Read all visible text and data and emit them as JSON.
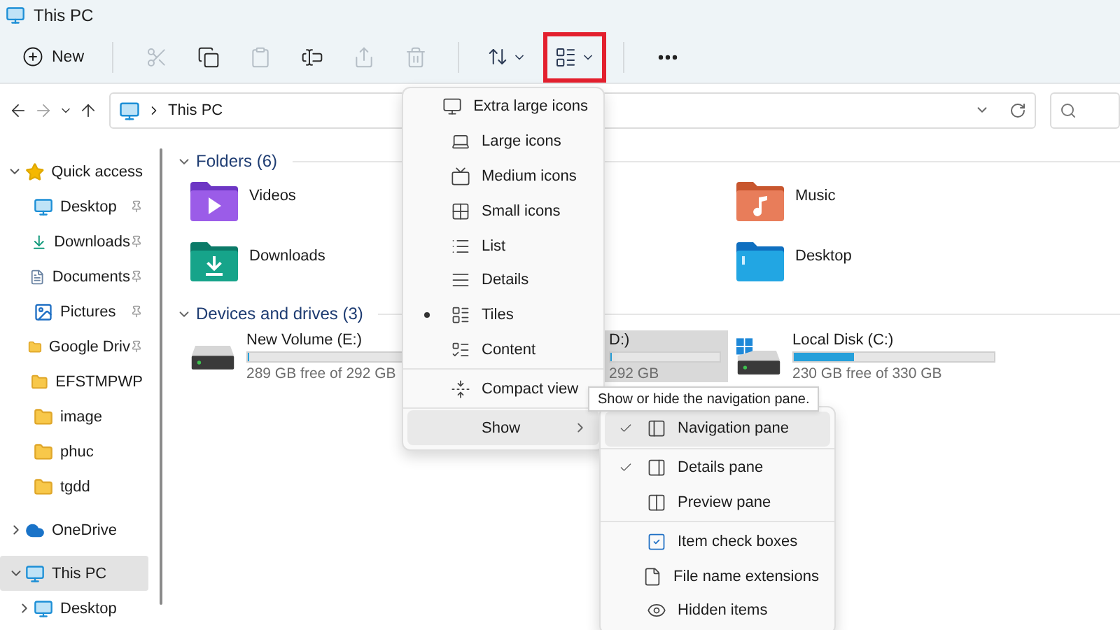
{
  "window": {
    "title": "This PC"
  },
  "toolbar": {
    "new": {
      "label": "New"
    },
    "actions": [
      {
        "kind": "cut",
        "disabled": true
      },
      {
        "kind": "copy",
        "disabled": false
      },
      {
        "kind": "paste",
        "disabled": true
      },
      {
        "kind": "rename",
        "disabled": false
      },
      {
        "kind": "share",
        "disabled": true
      },
      {
        "kind": "delete",
        "disabled": true
      }
    ],
    "view_button": {
      "highlighted": true
    }
  },
  "navigation": {
    "buttons": [
      {
        "kind": "back",
        "disabled": false
      },
      {
        "kind": "forward",
        "disabled": true
      },
      {
        "kind": "recent",
        "disabled": false
      },
      {
        "kind": "up",
        "disabled": false
      }
    ]
  },
  "address_bar": {
    "location": "This PC"
  },
  "sidebar": {
    "items": [
      {
        "label": "Quick access",
        "kind": "star",
        "expanded": true,
        "selected": false,
        "children": [
          {
            "label": "Desktop",
            "kind": "desktop",
            "pinned": true,
            "selected": false
          },
          {
            "label": "Downloads",
            "kind": "downloads",
            "pinned": true,
            "selected": false
          },
          {
            "label": "Documents",
            "kind": "documents",
            "pinned": true,
            "selected": false
          },
          {
            "label": "Pictures",
            "kind": "pictures",
            "pinned": true,
            "selected": false
          },
          {
            "label": "Google Driv",
            "kind": "folder",
            "pinned": true,
            "selected": false
          },
          {
            "label": "EFSTMPWP",
            "kind": "folder",
            "pinned": false,
            "selected": false
          },
          {
            "label": "image",
            "kind": "folder",
            "pinned": false,
            "selected": false
          },
          {
            "label": "phuc",
            "kind": "folder",
            "pinned": false,
            "selected": false
          },
          {
            "label": "tgdd",
            "kind": "folder",
            "pinned": false,
            "selected": false
          }
        ]
      },
      {
        "label": "OneDrive",
        "kind": "cloud",
        "expanded": false,
        "selected": false
      },
      {
        "label": "This PC",
        "kind": "pc",
        "expanded": true,
        "selected": true,
        "children": [
          {
            "label": "Desktop",
            "kind": "desktop",
            "expanded": false,
            "selected": false
          }
        ]
      }
    ]
  },
  "content": {
    "sections": [
      {
        "kind": "folders",
        "title": "Folders (6)",
        "expanded": true,
        "items": [
          {
            "name": "Videos",
            "kind": "videos"
          },
          {
            "name": "Music",
            "kind": "music"
          },
          {
            "name": "Downloads",
            "kind": "downloads"
          },
          {
            "name": "Desktop",
            "kind": "desktop"
          }
        ]
      },
      {
        "kind": "drives",
        "title": "Devices and drives (3)",
        "expanded": true,
        "items": [
          {
            "name": "New Volume (E:)",
            "free": "289 GB free of 292 GB",
            "level": 0.01,
            "selected": false,
            "kind": "drive"
          },
          {
            "name": "D:)",
            "free": "292 GB",
            "level": 0.01,
            "selected": true,
            "kind": "partial"
          },
          {
            "name": "Local Disk (C:)",
            "free": "230 GB free of 330 GB",
            "level": 0.3,
            "selected": false,
            "kind": "windows_drive"
          }
        ]
      }
    ]
  },
  "view_menu": {
    "items": [
      {
        "kind": "extra_large",
        "label": "Extra large icons",
        "selected": false,
        "hovered": false
      },
      {
        "kind": "large",
        "label": "Large icons",
        "selected": false,
        "hovered": false
      },
      {
        "kind": "medium",
        "label": "Medium icons",
        "selected": false,
        "hovered": false
      },
      {
        "kind": "small",
        "label": "Small icons",
        "selected": false,
        "hovered": false
      },
      {
        "kind": "list",
        "label": "List",
        "selected": false,
        "hovered": false
      },
      {
        "kind": "details",
        "label": "Details",
        "selected": false,
        "hovered": false
      },
      {
        "kind": "tiles",
        "label": "Tiles",
        "selected": true,
        "hovered": false
      },
      {
        "kind": "content",
        "label": "Content",
        "selected": false,
        "hovered": false
      },
      {
        "kind": "compact",
        "label": "Compact view",
        "checked": false,
        "hovered": false
      },
      {
        "kind": "show",
        "label": "Show",
        "hovered": true
      }
    ]
  },
  "tooltip": {
    "text": "Show or hide the navigation pane."
  },
  "show_menu": {
    "items": [
      {
        "kind": "navigation",
        "label": "Navigation pane",
        "checked": true,
        "hovered": true
      },
      {
        "kind": "details",
        "label": "Details pane",
        "checked": true,
        "hovered": false
      },
      {
        "kind": "preview",
        "label": "Preview pane",
        "checked": false,
        "hovered": false
      },
      {
        "kind": "checkboxes",
        "label": "Item check boxes",
        "checked": false,
        "hovered": false
      },
      {
        "kind": "extensions",
        "label": "File name extensions",
        "checked": false,
        "hovered": false
      },
      {
        "kind": "hidden",
        "label": "Hidden items",
        "checked": false,
        "hovered": false
      }
    ]
  }
}
